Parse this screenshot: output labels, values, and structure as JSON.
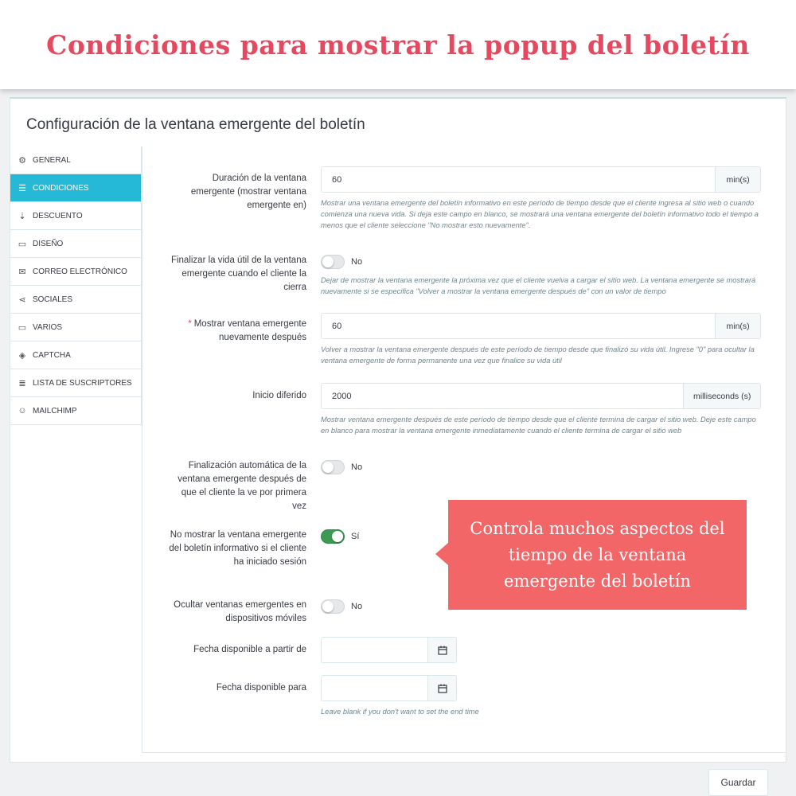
{
  "banner": {
    "title": "Condiciones para mostrar la popup del boletín"
  },
  "panel": {
    "title": "Configuración de la ventana emergente del boletín"
  },
  "sidebar": {
    "items": [
      {
        "label": "GENERAL",
        "icon": "gears-icon",
        "active": false
      },
      {
        "label": "CONDICIONES",
        "icon": "list-icon",
        "active": true
      },
      {
        "label": "DESCUENTO",
        "icon": "sort-icon",
        "active": false
      },
      {
        "label": "DISEÑO",
        "icon": "window-icon",
        "active": false
      },
      {
        "label": "CORREO ELECTRÓNICO",
        "icon": "envelope-icon",
        "active": false
      },
      {
        "label": "SOCIALES",
        "icon": "share-icon",
        "active": false
      },
      {
        "label": "VARIOS",
        "icon": "desktop-icon",
        "active": false
      },
      {
        "label": "CAPTCHA",
        "icon": "shield-icon",
        "active": false
      },
      {
        "label": "LISTA DE SUSCRIPTORES",
        "icon": "list-lines-icon",
        "active": false
      },
      {
        "label": "MAILCHIMP",
        "icon": "mailchimp-icon",
        "active": false
      }
    ]
  },
  "form": {
    "duration": {
      "label": "Duración de la ventana emergente (mostrar ventana emergente en)",
      "value": "60",
      "unit": "min(s)",
      "help": "Mostrar una ventana emergente del boletín informativo en este período de tiempo desde que el cliente ingresa al sitio web o cuando comienza una nueva vida. Si deja este campo en blanco, se mostrará una ventana emergente del boletín informativo todo el tiempo a menos que el cliente seleccione \"No mostrar esto nuevamente\"."
    },
    "end_life": {
      "label": "Finalizar la vida útil de la ventana emergente cuando el cliente la cierra",
      "state": "No",
      "on": false,
      "help": "Dejar de mostrar la ventana emergente la próxima vez que el cliente vuelva a cargar el sitio web. La ventana emergente se mostrará nuevamente si se especifica \"Volver a mostrar la ventana emergente después de\" con un valor de tiempo"
    },
    "show_again": {
      "required_mark": "*",
      "label": "Mostrar ventana emergente nuevamente después",
      "value": "60",
      "unit": "min(s)",
      "help": "Volver a mostrar la ventana emergente después de este período de tiempo desde que finalizó su vida útil. Ingrese \"0\" para ocultar la ventana emergente de forma permanente una vez que finalice su vida útil"
    },
    "delay": {
      "label": "Inicio diferido",
      "value": "2000",
      "unit": "milliseconds (s)",
      "help": "Mostrar ventana emergente después de este período de tiempo desde que el cliente termina de cargar el sitio web. Deje este campo en blanco para mostrar la ventana emergente inmediatamente cuando el cliente termina de cargar el sitio web"
    },
    "auto_end": {
      "label": "Finalización automática de la ventana emergente después de que el cliente la ve por primera vez",
      "state": "No",
      "on": false
    },
    "logged_in": {
      "label": "No mostrar la ventana emergente del boletín informativo si el cliente ha iniciado sesión",
      "state": "Sí",
      "on": true
    },
    "mobile": {
      "label": "Ocultar ventanas emergentes en dispositivos móviles",
      "state": "No",
      "on": false
    },
    "date_from": {
      "label": "Fecha disponible a partir de",
      "value": ""
    },
    "date_to": {
      "label": "Fecha disponible para",
      "value": "",
      "help": "Leave blank if you don't want to set the end time"
    }
  },
  "callout": {
    "text": "Controla muchos aspectos del tiempo de la ventana emergente del boletín"
  },
  "actions": {
    "save_label": "Guardar"
  },
  "colors": {
    "brand": "#e5495f",
    "active_tab": "#25b9d7",
    "toggle_on": "#3d9a53",
    "callout": "#f26667"
  }
}
